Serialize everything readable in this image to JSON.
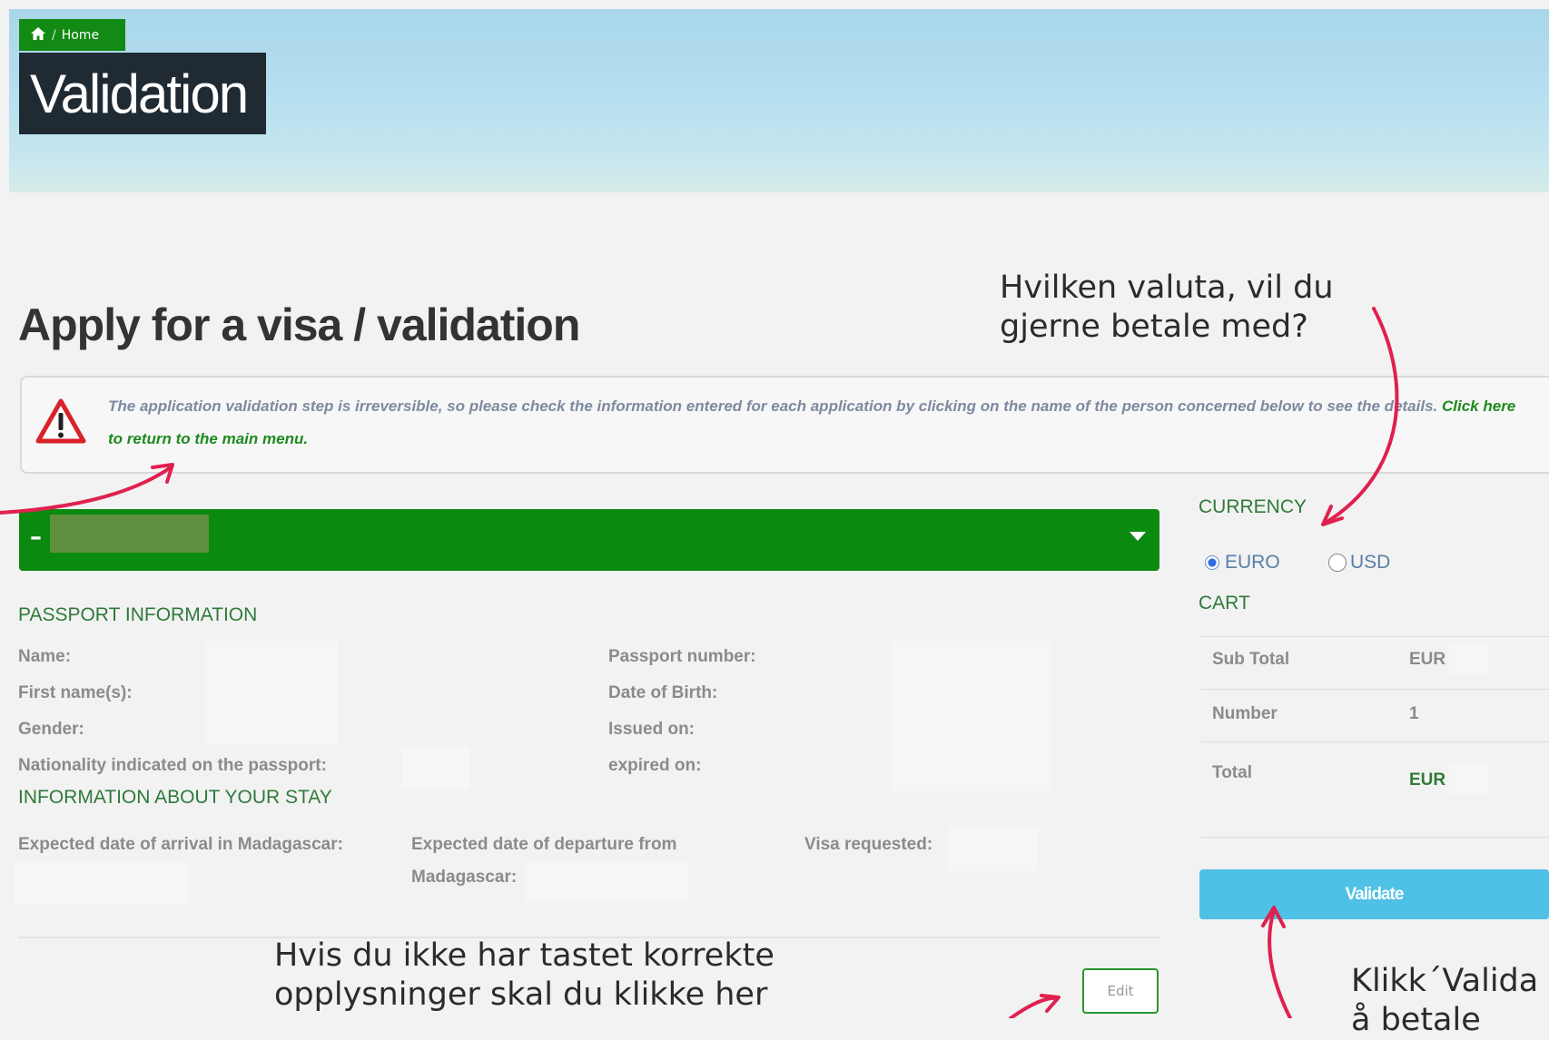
{
  "hero": {
    "breadcrumb_label": "Home",
    "title": "Validation"
  },
  "page": {
    "heading": "Apply for a visa / validation"
  },
  "alert": {
    "message": "The application validation step is irreversible, so please check the information entered for each application by clicking on the name of the person concerned below to see the details.",
    "link_text": "Click here to return to the main menu."
  },
  "application_bar": {
    "toggle_symbol": "–"
  },
  "passport": {
    "section_title": "PASSPORT INFORMATION",
    "name_label": "Name:",
    "first_names_label": "First name(s):",
    "gender_label": "Gender:",
    "nationality_label": "Nationality indicated on the passport:",
    "passport_number_label": "Passport number:",
    "dob_label": "Date of Birth:",
    "issued_label": "Issued on:",
    "expired_label": "expired on:"
  },
  "stay": {
    "section_title": "INFORMATION ABOUT YOUR STAY",
    "arrival_label": "Expected date of arrival in Madagascar:",
    "departure_label_line1": "Expected date of departure from",
    "departure_label_line2": "Madagascar:",
    "visa_label": "Visa requested:"
  },
  "currency": {
    "label": "CURRENCY",
    "options": [
      {
        "label": "EURO",
        "selected": true
      },
      {
        "label": "USD",
        "selected": false
      }
    ]
  },
  "cart": {
    "label": "CART",
    "rows": [
      {
        "key": "Sub Total",
        "value": "EUR"
      },
      {
        "key": "Number",
        "value": "1"
      },
      {
        "key": "Total",
        "value": "EUR"
      }
    ]
  },
  "buttons": {
    "validate": "Validate",
    "edit": "Edit"
  },
  "annotations": {
    "currency_note_line1": "Hvilken valuta, vil du",
    "currency_note_line2": "gjerne betale med?",
    "edit_note_line1": "Hvis du ikke har tastet korrekte",
    "edit_note_line2": "opplysninger skal du klikke her",
    "validate_note_line1": "Klikk´Valida",
    "validate_note_line2": "å betale"
  },
  "colors": {
    "brand_green": "#0b8a10",
    "validate_blue": "#4fc0e6",
    "annotation_arrow": "#e0204f",
    "dark_box": "#1f2a33"
  }
}
